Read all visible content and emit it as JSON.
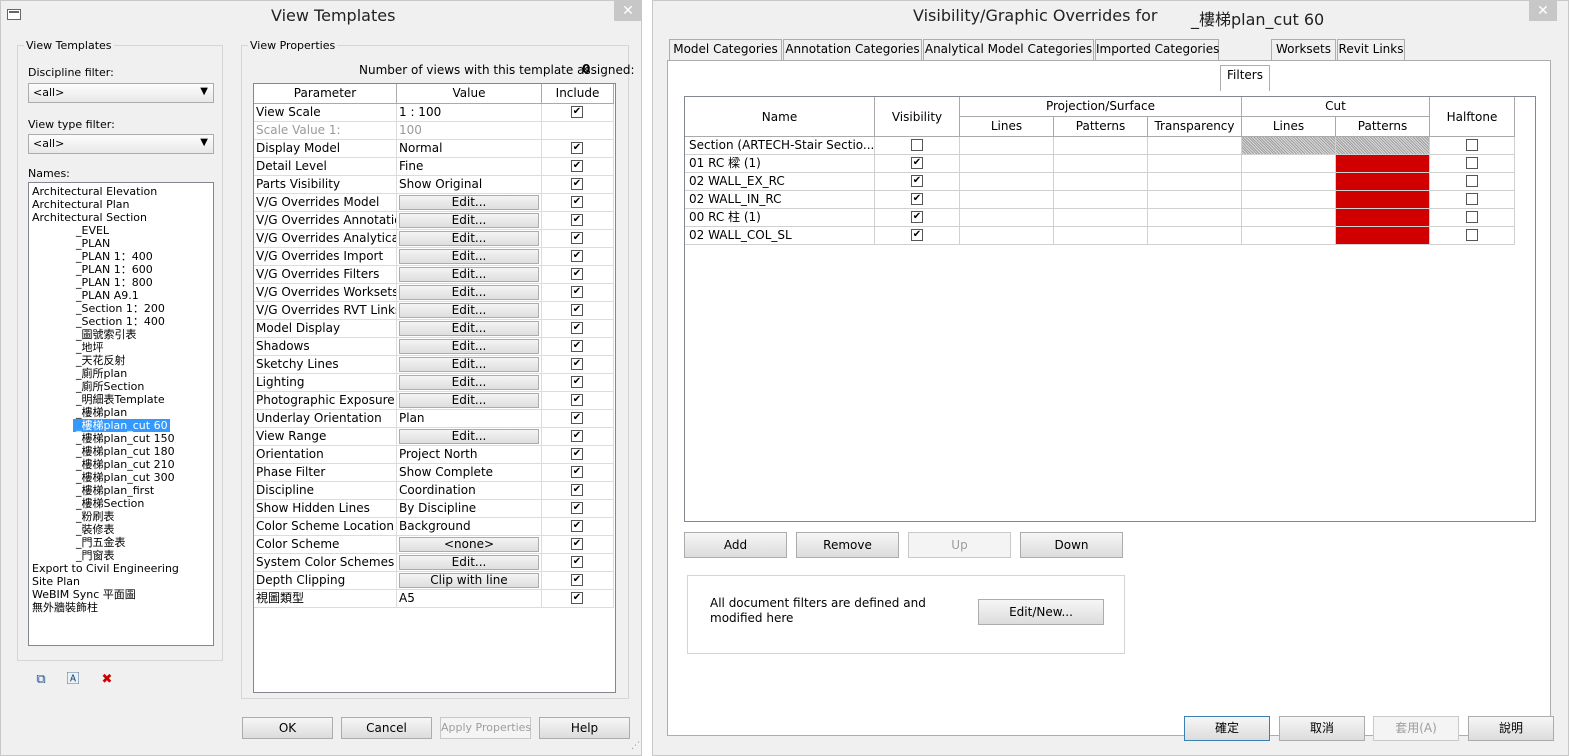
{
  "left_window": {
    "title": "View Templates",
    "close_label": "✕",
    "templates_group": "View Templates",
    "discipline_filter_label": "Discipline filter:",
    "discipline_filter_value": "<all>",
    "view_type_filter_label": "View type filter:",
    "view_type_filter_value": "<all>",
    "names_label": "Names:",
    "names": [
      {
        "label": "Architectural Elevation",
        "indent": 0
      },
      {
        "label": "Architectural Plan",
        "indent": 0
      },
      {
        "label": "Architectural Section",
        "indent": 0
      },
      {
        "label": "_EVEL",
        "indent": 1
      },
      {
        "label": "_PLAN",
        "indent": 1
      },
      {
        "label": "_PLAN 1：400",
        "indent": 1
      },
      {
        "label": "_PLAN 1：600",
        "indent": 1
      },
      {
        "label": "_PLAN 1：800",
        "indent": 1
      },
      {
        "label": "_PLAN A9.1",
        "indent": 1
      },
      {
        "label": "_Section 1：200",
        "indent": 1
      },
      {
        "label": "_Section 1：400",
        "indent": 1
      },
      {
        "label": "_圖號索引表",
        "indent": 1
      },
      {
        "label": "_地坪",
        "indent": 1
      },
      {
        "label": "_天花反射",
        "indent": 1
      },
      {
        "label": "_廁所plan",
        "indent": 1
      },
      {
        "label": "_廁所Section",
        "indent": 1
      },
      {
        "label": "_明細表Template",
        "indent": 1
      },
      {
        "label": "_樓梯plan",
        "indent": 1
      },
      {
        "label": "_樓梯plan_cut 60",
        "indent": 1,
        "selected": true
      },
      {
        "label": "_樓梯plan_cut 150",
        "indent": 1
      },
      {
        "label": "_樓梯plan_cut 180",
        "indent": 1
      },
      {
        "label": "_樓梯plan_cut 210",
        "indent": 1
      },
      {
        "label": "_樓梯plan_cut 300",
        "indent": 1
      },
      {
        "label": "_樓梯plan_first",
        "indent": 1
      },
      {
        "label": "_樓梯Section",
        "indent": 1
      },
      {
        "label": "_粉刷表",
        "indent": 1
      },
      {
        "label": "_裝修表",
        "indent": 1
      },
      {
        "label": "_門五金表",
        "indent": 1
      },
      {
        "label": "_門窗表",
        "indent": 1
      },
      {
        "label": "Export to Civil Engineering",
        "indent": 0
      },
      {
        "label": "Site Plan",
        "indent": 0
      },
      {
        "label": "WeBIM Sync 平面圖",
        "indent": 0
      },
      {
        "label": "無外牆裝飾柱",
        "indent": 0
      }
    ],
    "view_properties_group": "View Properties",
    "views_assigned_label": "Number of views with this template assigned:",
    "views_assigned_count": "0",
    "grid_headers": {
      "parameter": "Parameter",
      "value": "Value",
      "include": "Include"
    },
    "properties": [
      {
        "param": "View Scale",
        "value": "1 : 100",
        "include": true
      },
      {
        "param": "Scale Value    1:",
        "value": "100",
        "include": null,
        "disabled": true
      },
      {
        "param": "Display Model",
        "value": "Normal",
        "include": true
      },
      {
        "param": "Detail Level",
        "value": "Fine",
        "include": true
      },
      {
        "param": "Parts Visibility",
        "value": "Show Original",
        "include": true
      },
      {
        "param": "V/G Overrides Model",
        "button": "Edit...",
        "include": true
      },
      {
        "param": "V/G Overrides Annotatio",
        "button": "Edit...",
        "include": true
      },
      {
        "param": "V/G Overrides Analytical",
        "button": "Edit...",
        "include": true
      },
      {
        "param": "V/G Overrides Import",
        "button": "Edit...",
        "include": true
      },
      {
        "param": "V/G Overrides Filters",
        "button": "Edit...",
        "include": true
      },
      {
        "param": "V/G Overrides Worksets",
        "button": "Edit...",
        "include": true
      },
      {
        "param": "V/G Overrides RVT Links",
        "button": "Edit...",
        "include": true
      },
      {
        "param": "Model Display",
        "button": "Edit...",
        "include": true
      },
      {
        "param": "Shadows",
        "button": "Edit...",
        "include": true
      },
      {
        "param": "Sketchy Lines",
        "button": "Edit...",
        "include": true
      },
      {
        "param": "Lighting",
        "button": "Edit...",
        "include": true
      },
      {
        "param": "Photographic Exposure",
        "button": "Edit...",
        "include": true
      },
      {
        "param": "Underlay Orientation",
        "value": "Plan",
        "include": true
      },
      {
        "param": "View Range",
        "button": "Edit...",
        "include": true
      },
      {
        "param": "Orientation",
        "value": "Project North",
        "include": true
      },
      {
        "param": "Phase Filter",
        "value": "Show Complete",
        "include": true
      },
      {
        "param": "Discipline",
        "value": "Coordination",
        "include": true
      },
      {
        "param": "Show Hidden Lines",
        "value": "By Discipline",
        "include": true
      },
      {
        "param": "Color Scheme Location",
        "value": "Background",
        "include": true
      },
      {
        "param": "Color Scheme",
        "button": "<none>",
        "include": true
      },
      {
        "param": "System Color Schemes",
        "button": "Edit...",
        "include": true
      },
      {
        "param": "Depth Clipping",
        "button": "Clip with line",
        "include": true
      },
      {
        "param": "視圖類型",
        "value": "A5",
        "include": true
      }
    ],
    "buttons": {
      "ok": "OK",
      "cancel": "Cancel",
      "apply": "Apply Properties",
      "help": "Help"
    }
  },
  "right_window": {
    "title": "Visibility/Graphic Overrides for",
    "title_suffix": "_樓梯plan_cut 60",
    "close_label": "✕",
    "tabs": [
      "Model Categories",
      "Annotation Categories",
      "Analytical Model Categories",
      "Imported Categories",
      "Filters",
      "Worksets",
      "Revit Links"
    ],
    "active_tab": "Filters",
    "grid_headers": {
      "name": "Name",
      "visibility": "Visibility",
      "projection": "Projection/Surface",
      "cut": "Cut",
      "halftone": "Halftone",
      "lines": "Lines",
      "patterns": "Patterns",
      "transparency": "Transparency",
      "cut_lines": "Lines",
      "cut_patterns": "Patterns"
    },
    "filters": [
      {
        "name": "Section (ARTECH-Stair Sectio...",
        "visible": false,
        "cut_override": "hatch",
        "halftone": false
      },
      {
        "name": "01 RC 樑 (1)",
        "visible": true,
        "cut_override": "red",
        "halftone": false
      },
      {
        "name": "02 WALL_EX_RC",
        "visible": true,
        "cut_override": "red",
        "halftone": false
      },
      {
        "name": "02 WALL_IN_RC",
        "visible": true,
        "cut_override": "red",
        "halftone": false
      },
      {
        "name": "00 RC 柱 (1)",
        "visible": true,
        "cut_override": "red",
        "halftone": false
      },
      {
        "name": "02 WALL_COL_SL",
        "visible": true,
        "cut_override": "red",
        "halftone": false
      }
    ],
    "grid_buttons": {
      "add": "Add",
      "remove": "Remove",
      "up": "Up",
      "down": "Down"
    },
    "info_text": "All document filters are defined and modified here",
    "edit_new_label": "Edit/New...",
    "footer_buttons": {
      "ok": "確定",
      "cancel": "取消",
      "apply": "套用(A)",
      "help": "說明"
    },
    "colors": {
      "cut_red": "#d00000",
      "selection": "#3399ff"
    }
  }
}
